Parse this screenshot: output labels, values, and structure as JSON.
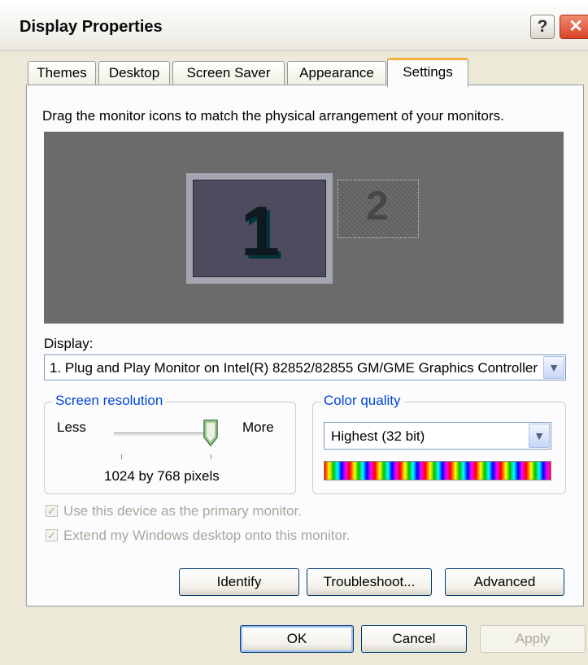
{
  "window": {
    "title": "Display Properties",
    "help_glyph": "?",
    "close_glyph": "✕"
  },
  "tabs": [
    {
      "label": "Themes"
    },
    {
      "label": "Desktop"
    },
    {
      "label": "Screen Saver"
    },
    {
      "label": "Appearance"
    },
    {
      "label": "Settings"
    }
  ],
  "settings": {
    "instruction": "Drag the monitor icons to match the physical arrangement of your monitors.",
    "monitors": [
      {
        "number": "1",
        "selected": true
      },
      {
        "number": "2",
        "selected": false
      }
    ],
    "display_label": "Display:",
    "display_value": "1. Plug and Play Monitor on Intel(R) 82852/82855 GM/GME Graphics Controller",
    "screen_resolution": {
      "title": "Screen resolution",
      "less_label": "Less",
      "more_label": "More",
      "value_text": "1024 by 768 pixels",
      "slider_position": 1.0
    },
    "color_quality": {
      "title": "Color quality",
      "selected": "Highest (32 bit)"
    },
    "checkboxes": [
      {
        "label": "Use this device as the primary monitor.",
        "checked": true,
        "enabled": false
      },
      {
        "label": "Extend my Windows desktop onto this monitor.",
        "checked": true,
        "enabled": false
      }
    ],
    "buttons": {
      "identify": "Identify",
      "troubleshoot": "Troubleshoot...",
      "advanced": "Advanced"
    }
  },
  "footer": {
    "ok": "OK",
    "cancel": "Cancel",
    "apply": "Apply"
  },
  "colors": {
    "accent_tab": "#f5b040",
    "group_title": "#0046d5",
    "close_button": "#d9432a",
    "monitor_area": "#6b6b6b"
  }
}
